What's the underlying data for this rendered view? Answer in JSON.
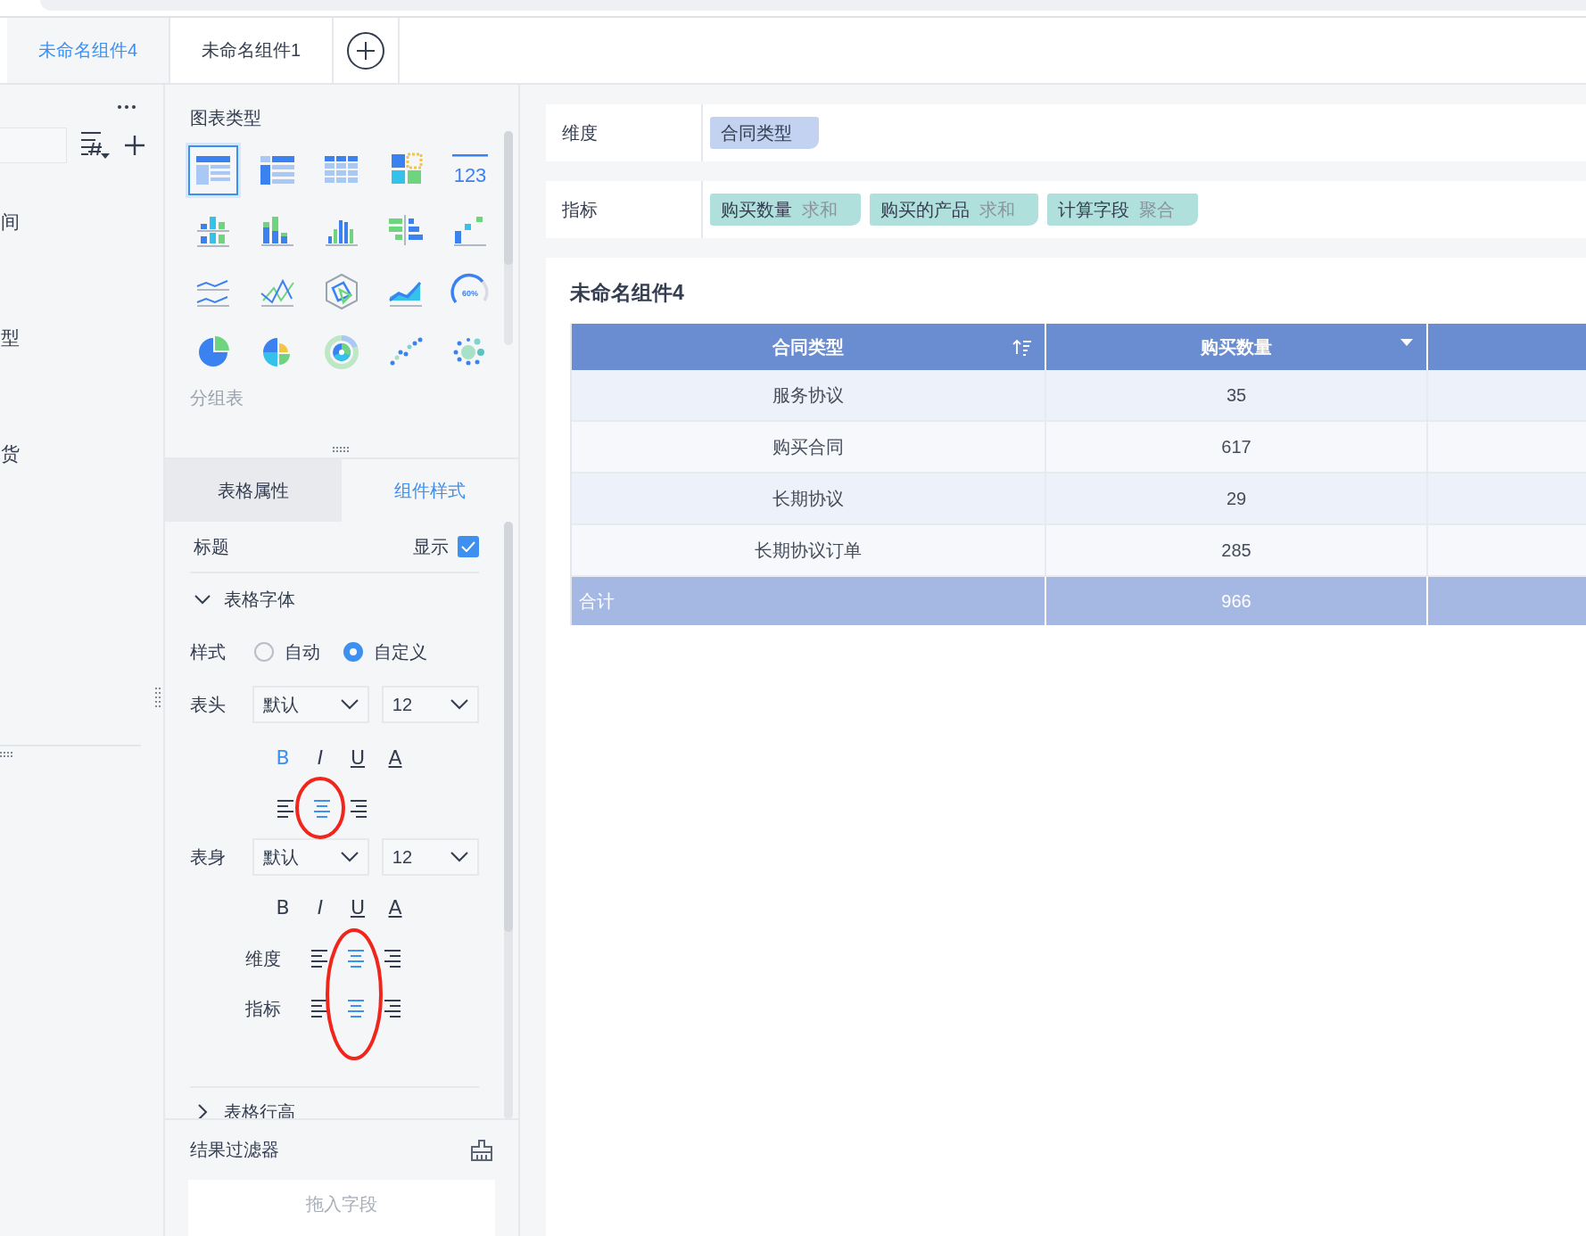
{
  "tabs": [
    {
      "label": "未命名组件4",
      "selected": true
    },
    {
      "label": "未命名组件1",
      "selected": false
    }
  ],
  "left_panel": {
    "items": [
      "间",
      "型",
      "货"
    ]
  },
  "chart_types": {
    "title": "图表类型",
    "items": [
      {
        "kind": "table",
        "selected": true
      },
      {
        "kind": "cross-table",
        "selected": false
      },
      {
        "kind": "detail-table",
        "selected": false
      },
      {
        "kind": "blocks",
        "selected": false
      },
      {
        "kind": "kpi",
        "text": "123",
        "selected": false
      },
      {
        "kind": "stacked-column",
        "selected": false
      },
      {
        "kind": "column-stack",
        "selected": false
      },
      {
        "kind": "column",
        "selected": false
      },
      {
        "kind": "bar",
        "selected": false
      },
      {
        "kind": "waterfall",
        "selected": false
      },
      {
        "kind": "multi-line",
        "selected": false
      },
      {
        "kind": "mixed-line",
        "selected": false
      },
      {
        "kind": "radar",
        "selected": false
      },
      {
        "kind": "area",
        "selected": false
      },
      {
        "kind": "gauge",
        "text": "60%",
        "selected": false
      },
      {
        "kind": "pie",
        "selected": false
      },
      {
        "kind": "rose",
        "selected": false
      },
      {
        "kind": "sunburst",
        "selected": false
      },
      {
        "kind": "scatter",
        "selected": false
      },
      {
        "kind": "bubble",
        "selected": false
      }
    ],
    "caption": "分组表"
  },
  "style_tabs": [
    {
      "label": "表格属性",
      "selected": false
    },
    {
      "label": "组件样式",
      "selected": true
    }
  ],
  "title_row": {
    "label": "标题",
    "toggle_label": "显示",
    "checked": true
  },
  "font_section": {
    "title": "表格字体",
    "expanded": true,
    "style": {
      "label": "样式",
      "options": [
        {
          "label": "自动",
          "selected": false
        },
        {
          "label": "自定义",
          "selected": true
        }
      ]
    },
    "header": {
      "label": "表头",
      "font": "默认",
      "size": "12",
      "format": [
        {
          "kind": "bold",
          "label": "B",
          "active": true
        },
        {
          "kind": "italic",
          "label": "I",
          "active": false
        },
        {
          "kind": "underline",
          "label": "U",
          "active": false
        },
        {
          "kind": "color",
          "label": "A",
          "active": false
        }
      ],
      "align": [
        {
          "kind": "left",
          "selected": false
        },
        {
          "kind": "center",
          "selected": true
        },
        {
          "kind": "right",
          "selected": false
        }
      ]
    },
    "body": {
      "label": "表身",
      "font": "默认",
      "size": "12",
      "format": [
        {
          "kind": "bold",
          "label": "B",
          "active": false
        },
        {
          "kind": "italic",
          "label": "I",
          "active": false
        },
        {
          "kind": "underline",
          "label": "U",
          "active": false
        },
        {
          "kind": "color",
          "label": "A",
          "active": false
        }
      ],
      "align_rows": [
        {
          "label": "维度",
          "align": [
            {
              "kind": "left",
              "selected": false
            },
            {
              "kind": "center",
              "selected": true
            },
            {
              "kind": "right",
              "selected": false
            }
          ]
        },
        {
          "label": "指标",
          "align": [
            {
              "kind": "left",
              "selected": false
            },
            {
              "kind": "center",
              "selected": true
            },
            {
              "kind": "right",
              "selected": false
            }
          ]
        }
      ]
    }
  },
  "row_height_section": {
    "title": "表格行高",
    "expanded": false
  },
  "result_filter": {
    "title": "结果过滤器",
    "placeholder": "拖入字段"
  },
  "dimension": {
    "label": "维度",
    "fields": [
      {
        "name": "合同类型"
      }
    ]
  },
  "metrics": {
    "label": "指标",
    "fields": [
      {
        "name": "购买数量",
        "aggregation": "求和"
      },
      {
        "name": "购买的产品",
        "aggregation": "求和"
      },
      {
        "name": "计算字段",
        "aggregation": "聚合"
      }
    ]
  },
  "widget": {
    "title": "未命名组件4",
    "columns": [
      {
        "label": "合同类型",
        "kind": "sort"
      },
      {
        "label": "购买数量",
        "kind": "menu"
      }
    ],
    "rows": [
      [
        "服务协议",
        "35"
      ],
      [
        "购买合同",
        "617"
      ],
      [
        "长期协议",
        "29"
      ],
      [
        "长期协议订单",
        "285"
      ]
    ],
    "total": [
      "合计",
      "966"
    ]
  },
  "annotations": [
    {
      "kind": "circle"
    },
    {
      "kind": "ellipse"
    }
  ]
}
